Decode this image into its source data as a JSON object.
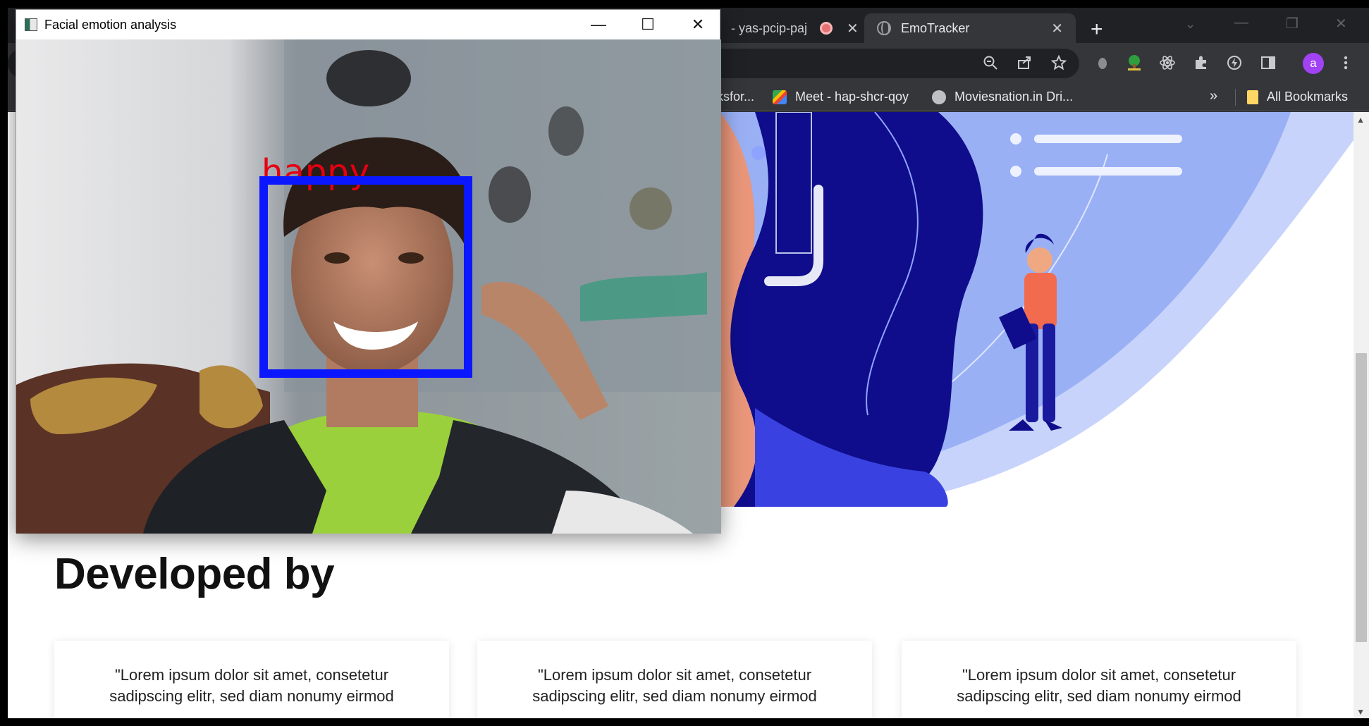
{
  "cv_window": {
    "title": "Facial emotion analysis",
    "emotion_label": "happy",
    "controls": {
      "minimize": "—",
      "maximize": "☐",
      "close": "✕"
    },
    "box_color": "#0b18ff",
    "label_color": "#e60012"
  },
  "browser": {
    "tabs": [
      {
        "title": "- yas-pcip-paj",
        "recording": true,
        "close": "✕"
      },
      {
        "title": "EmoTracker",
        "active": true,
        "close": "✕"
      }
    ],
    "new_tab": "+",
    "tab_search": "⌄",
    "window_controls": {
      "minimize": "—",
      "restore": "❐",
      "close": "✕"
    },
    "toolbar_icons": [
      "zoom-icon",
      "share-icon",
      "star-icon",
      "extension-icon",
      "tree-icon",
      "react-icon",
      "puzzle-icon",
      "bolt-icon",
      "sidepanel-icon",
      "menu-icon"
    ],
    "profile_initial": "a",
    "bookmarks": [
      {
        "label": "ksfor..."
      },
      {
        "label": "Meet - hap-shcr-qoy",
        "icon": "meet-icon"
      },
      {
        "label": "Moviesnation.in Dri...",
        "icon": "globe-icon"
      }
    ],
    "bookmarks_more": "»",
    "all_bookmarks": "All Bookmarks"
  },
  "page": {
    "heading": "Developed by",
    "cards": [
      {
        "line1": "\"Lorem ipsum dolor sit amet, consetetur",
        "line2": "sadipscing elitr, sed diam nonumy eirmod"
      },
      {
        "line1": "\"Lorem ipsum dolor sit amet, consetetur",
        "line2": "sadipscing elitr, sed diam nonumy eirmod"
      },
      {
        "line1": "\"Lorem ipsum dolor sit amet, consetetur",
        "line2": "sadipscing elitr, sed diam nonumy eirmod"
      }
    ],
    "scroll_up": "▲",
    "scroll_down": "▼"
  }
}
